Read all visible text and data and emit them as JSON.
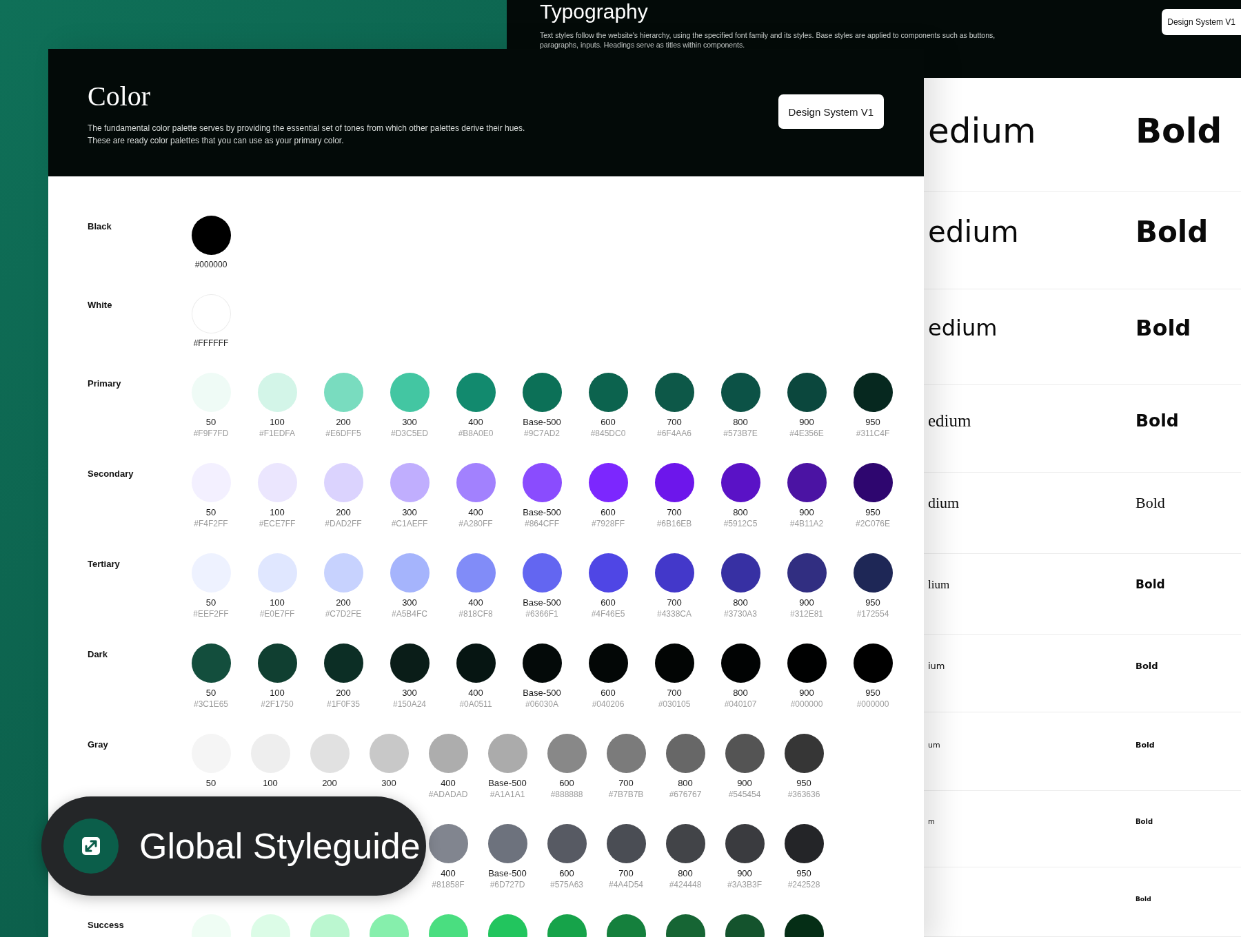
{
  "typography_panel": {
    "title": "Typography",
    "description": [
      "Text styles follow the website's hierarchy, using the specified font family and its styles. Base styles are applied to components such as buttons,",
      "paragraphs, inputs. Headings serve as titles within components."
    ],
    "button": "Design System V1",
    "rows": [
      {
        "medium": {
          "text": "edium",
          "kind": "sans"
        },
        "bold": {
          "text": "Bold",
          "kind": "sans"
        }
      },
      {
        "medium": {
          "text": "edium",
          "kind": "sans"
        },
        "bold": {
          "text": "Bold",
          "kind": "sans"
        }
      },
      {
        "medium": {
          "text": "edium",
          "kind": "sans"
        },
        "bold": {
          "text": "Bold",
          "kind": "sans"
        }
      },
      {
        "medium": {
          "text": "edium",
          "kind": "serif"
        },
        "bold": {
          "text": "Bold",
          "kind": "sans"
        }
      },
      {
        "medium": {
          "text": "dium",
          "kind": "serif"
        },
        "bold": {
          "text": "Bold",
          "kind": "serif"
        }
      },
      {
        "medium": {
          "text": "lium",
          "kind": "serif"
        },
        "bold": {
          "text": "Bold",
          "kind": "sans"
        }
      },
      {
        "medium": {
          "text": "ium",
          "kind": "sans"
        },
        "bold": {
          "text": "Bold",
          "kind": "sans"
        }
      },
      {
        "medium": {
          "text": "um",
          "kind": "sans"
        },
        "bold": {
          "text": "Bold",
          "kind": "sans"
        }
      },
      {
        "medium": {
          "text": "m",
          "kind": "sans"
        },
        "bold": {
          "text": "Bold",
          "kind": "sans"
        }
      },
      {
        "bold": {
          "text": "Bold",
          "kind": "sans"
        }
      }
    ]
  },
  "color_panel": {
    "title": "Color",
    "description": [
      "The fundamental color palette serves by providing the essential set of tones from which other palettes derive their hues.",
      "These are ready color palettes that you can use as your primary color."
    ],
    "button": "Design System V1",
    "palettes": [
      {
        "label": "Black",
        "kind": "single",
        "swatches": [
          {
            "hex": "#000000",
            "color": "#000000"
          }
        ]
      },
      {
        "label": "White",
        "kind": "single",
        "swatches": [
          {
            "hex": "#FFFFFF",
            "color": "#ffffff"
          }
        ]
      },
      {
        "label": "Primary",
        "kind": "wide",
        "swatches": [
          {
            "step": "50",
            "hex": "#F9F7FD",
            "color": "#effbf6"
          },
          {
            "step": "100",
            "hex": "#F1EDFA",
            "color": "#d3f5e8"
          },
          {
            "step": "200",
            "hex": "#E6DFF5",
            "color": "#79dcbf"
          },
          {
            "step": "300",
            "hex": "#D3C5ED",
            "color": "#43c6a2"
          },
          {
            "step": "400",
            "hex": "#B8A0E0",
            "color": "#128a6e"
          },
          {
            "step": "Base-500",
            "hex": "#9C7AD2",
            "color": "#0c7057"
          },
          {
            "step": "600",
            "hex": "#845DC0",
            "color": "#0c634e"
          },
          {
            "step": "700",
            "hex": "#6F4AA6",
            "color": "#0d5848"
          },
          {
            "step": "800",
            "hex": "#573B7E",
            "color": "#0c5246"
          },
          {
            "step": "900",
            "hex": "#4E356E",
            "color": "#0b473d"
          },
          {
            "step": "950",
            "hex": "#311C4F",
            "color": "#06281f"
          }
        ]
      },
      {
        "label": "Secondary",
        "kind": "wide",
        "swatches": [
          {
            "step": "50",
            "hex": "#F4F2FF",
            "color": "#f3f0ff"
          },
          {
            "step": "100",
            "hex": "#ECE7FF",
            "color": "#ebe6fe"
          },
          {
            "step": "200",
            "hex": "#DAD2FF",
            "color": "#dbd3fe"
          },
          {
            "step": "300",
            "hex": "#C1AEFF",
            "color": "#c0aefe"
          },
          {
            "step": "400",
            "hex": "#A280FF",
            "color": "#a281fe"
          },
          {
            "step": "Base-500",
            "hex": "#864CFF",
            "color": "#8a4cfe"
          },
          {
            "step": "600",
            "hex": "#7928FF",
            "color": "#7c27fe"
          },
          {
            "step": "700",
            "hex": "#6B16EB",
            "color": "#6d16eb"
          },
          {
            "step": "800",
            "hex": "#5912C5",
            "color": "#5a12c6"
          },
          {
            "step": "900",
            "hex": "#4B11A2",
            "color": "#4b13a3"
          },
          {
            "step": "950",
            "hex": "#2C076E",
            "color": "#2e066f"
          }
        ]
      },
      {
        "label": "Tertiary",
        "kind": "wide",
        "swatches": [
          {
            "step": "50",
            "hex": "#EEF2FF",
            "color": "#eef2ff"
          },
          {
            "step": "100",
            "hex": "#E0E7FF",
            "color": "#e0e7ff"
          },
          {
            "step": "200",
            "hex": "#C7D2FE",
            "color": "#c7d2fe"
          },
          {
            "step": "300",
            "hex": "#A5B4FC",
            "color": "#a5b4fc"
          },
          {
            "step": "400",
            "hex": "#818CF8",
            "color": "#818cf8"
          },
          {
            "step": "Base-500",
            "hex": "#6366F1",
            "color": "#6366f1"
          },
          {
            "step": "600",
            "hex": "#4F46E5",
            "color": "#4f46e5"
          },
          {
            "step": "700",
            "hex": "#4338CA",
            "color": "#4338ca"
          },
          {
            "step": "800",
            "hex": "#3730A3",
            "color": "#3730a3"
          },
          {
            "step": "900",
            "hex": "#312E81",
            "color": "#312e81"
          },
          {
            "step": "950",
            "hex": "#172554",
            "color": "#1e2756"
          }
        ]
      },
      {
        "label": "Dark",
        "kind": "wide",
        "swatches": [
          {
            "step": "50",
            "hex": "#3C1E65",
            "color": "#134e3d"
          },
          {
            "step": "100",
            "hex": "#2F1750",
            "color": "#103f31"
          },
          {
            "step": "200",
            "hex": "#1F0F35",
            "color": "#0c2e25"
          },
          {
            "step": "300",
            "hex": "#150A24",
            "color": "#0a1d18"
          },
          {
            "step": "400",
            "hex": "#0A0511",
            "color": "#061512"
          },
          {
            "step": "Base-500",
            "hex": "#06030A",
            "color": "#040a09"
          },
          {
            "step": "600",
            "hex": "#040206",
            "color": "#030706"
          },
          {
            "step": "700",
            "hex": "#030105",
            "color": "#020504"
          },
          {
            "step": "800",
            "hex": "#040107",
            "color": "#010303"
          },
          {
            "step": "900",
            "hex": "#000000",
            "color": "#000101"
          },
          {
            "step": "950",
            "hex": "#000000",
            "color": "#000000"
          }
        ]
      },
      {
        "label": "Gray",
        "kind": "narrow",
        "swatches": [
          {
            "step": "50",
            "color": "#f5f5f5"
          },
          {
            "step": "100",
            "color": "#eeeeee"
          },
          {
            "step": "200",
            "color": "#e1e1e1"
          },
          {
            "step": "300",
            "color": "#c8c8c8"
          },
          {
            "step": "400",
            "hex": "#ADADAD",
            "color": "#adadad"
          },
          {
            "step": "Base-500",
            "hex": "#A1A1A1",
            "color": "#ababab"
          },
          {
            "step": "600",
            "hex": "#888888",
            "color": "#888888"
          },
          {
            "step": "700",
            "hex": "#7B7B7B",
            "color": "#7b7b7b"
          },
          {
            "step": "800",
            "hex": "#676767",
            "color": "#676767"
          },
          {
            "step": "900",
            "hex": "#545454",
            "color": "#545454"
          },
          {
            "step": "950",
            "hex": "#363636",
            "color": "#363636"
          }
        ]
      },
      {
        "kind": "narrow",
        "swatches": [
          {
            "step": "400",
            "hex": "#81858F",
            "color": "#81858f"
          },
          {
            "step": "Base-500",
            "hex": "#6D727D",
            "color": "#6d727d"
          },
          {
            "step": "600",
            "hex": "#575A63",
            "color": "#575a63"
          },
          {
            "step": "700",
            "hex": "#4A4D54",
            "color": "#4a4d54"
          },
          {
            "step": "800",
            "hex": "#424448",
            "color": "#424448"
          },
          {
            "step": "900",
            "hex": "#3A3B3F",
            "color": "#3a3b3f"
          },
          {
            "step": "950",
            "hex": "#242528",
            "color": "#242528"
          }
        ]
      },
      {
        "label": "Success",
        "kind": "narrow",
        "swatches": [
          {
            "color": "#effdf4"
          },
          {
            "color": "#dcfce7"
          },
          {
            "color": "#bbf7d0"
          },
          {
            "color": "#86efac"
          },
          {
            "color": "#4ade80"
          },
          {
            "color": "#22c55e"
          },
          {
            "color": "#16a34a"
          },
          {
            "color": "#15803d"
          },
          {
            "color": "#166534"
          },
          {
            "color": "#14532d"
          },
          {
            "color": "#052e16"
          }
        ]
      }
    ]
  },
  "badge": {
    "label": "Global Styleguide"
  }
}
